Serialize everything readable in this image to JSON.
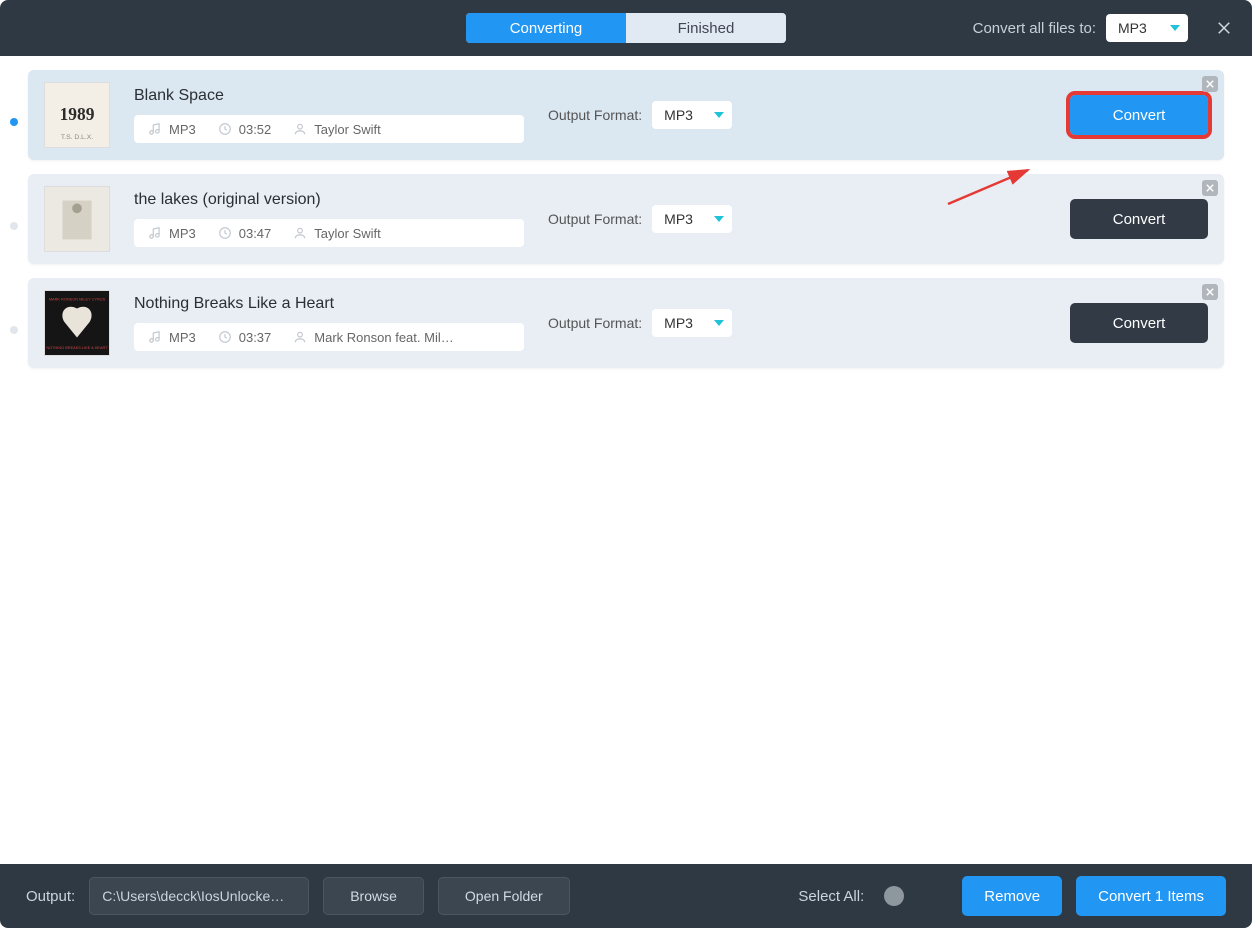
{
  "header": {
    "tab_converting": "Converting",
    "tab_finished": "Finished",
    "convert_all_label": "Convert all files to:",
    "format_all": "MP3"
  },
  "tracks": [
    {
      "title": "Blank Space",
      "codec": "MP3",
      "duration": "03:52",
      "artist": "Taylor Swift",
      "output_label": "Output Format:",
      "output_format": "MP3",
      "convert_label": "Convert",
      "selected": true
    },
    {
      "title": "the lakes (original version)",
      "codec": "MP3",
      "duration": "03:47",
      "artist": "Taylor Swift",
      "output_label": "Output Format:",
      "output_format": "MP3",
      "convert_label": "Convert",
      "selected": false
    },
    {
      "title": "Nothing Breaks Like a Heart",
      "codec": "MP3",
      "duration": "03:37",
      "artist": "Mark Ronson feat. Mil…",
      "output_label": "Output Format:",
      "output_format": "MP3",
      "convert_label": "Convert",
      "selected": false
    }
  ],
  "footer": {
    "output_label": "Output:",
    "output_path": "C:\\Users\\decck\\IosUnlocke…",
    "browse": "Browse",
    "open_folder": "Open Folder",
    "select_all": "Select All:",
    "remove": "Remove",
    "convert_items": "Convert 1 Items"
  }
}
